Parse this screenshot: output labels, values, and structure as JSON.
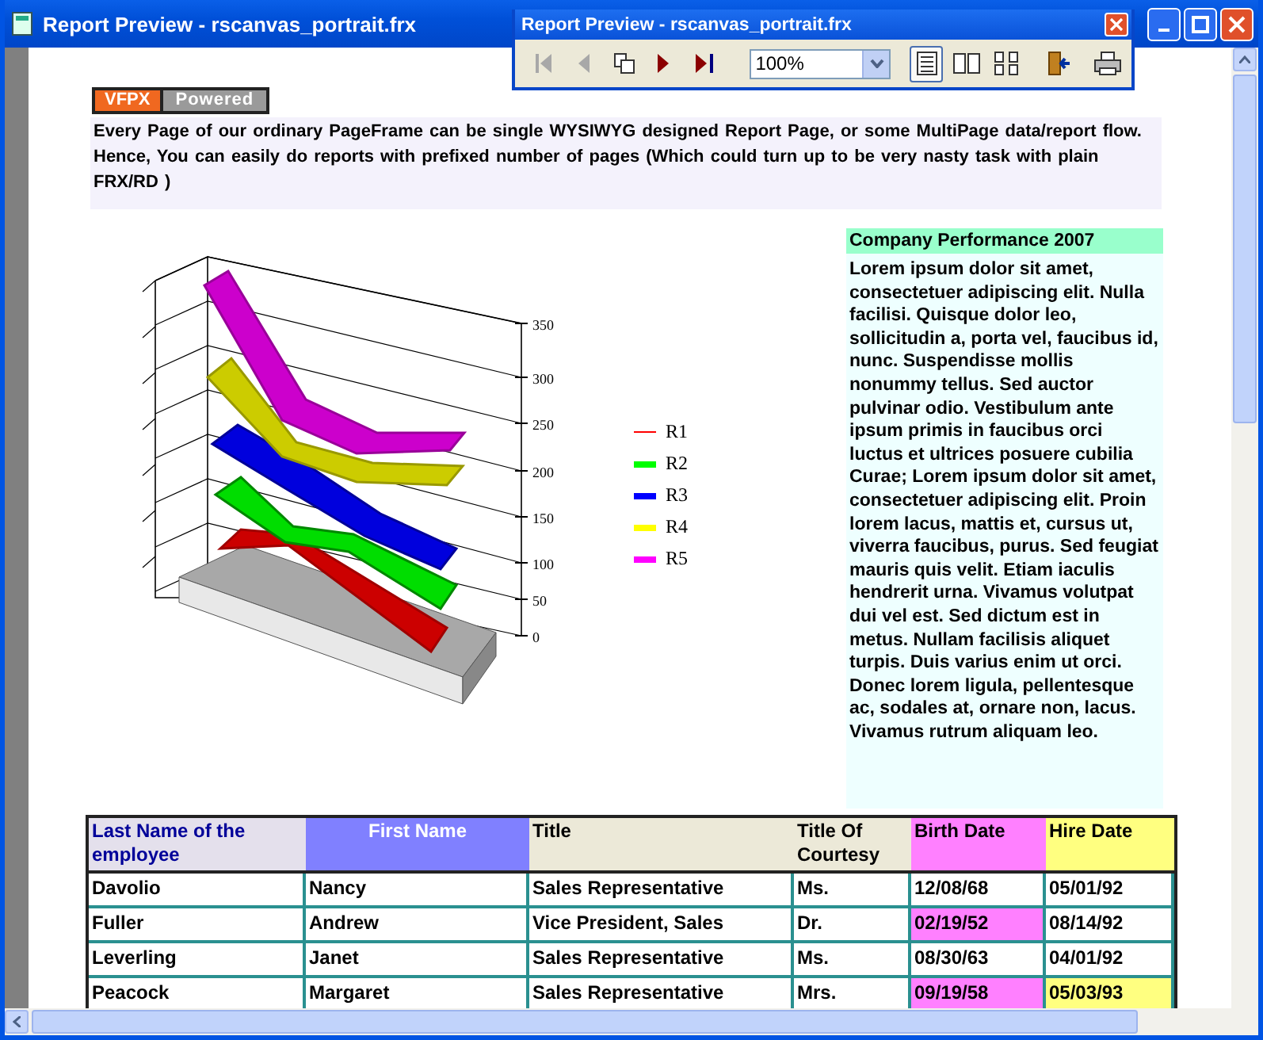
{
  "window": {
    "title": "Report Preview - rscanvas_portrait.frx"
  },
  "toolbar": {
    "title": "Report Preview - rscanvas_portrait.frx",
    "zoom": "100%",
    "nav": [
      {
        "kind": "first",
        "disabled": true
      },
      {
        "kind": "prev",
        "disabled": true
      },
      {
        "kind": "goto",
        "disabled": false
      },
      {
        "kind": "next",
        "disabled": false
      },
      {
        "kind": "last",
        "disabled": false
      }
    ],
    "views": [
      {
        "kind": "one",
        "selected": true
      },
      {
        "kind": "two",
        "selected": false
      },
      {
        "kind": "four",
        "selected": false
      }
    ]
  },
  "logo": {
    "left": "VFPX",
    "right": "Powered"
  },
  "intro": "Every Page of our ordinary PageFrame can be single  WYSIWYG designed Report Page, or some MultiPage data/report  flow.  Hence, You can easily do reports with prefixed number of pages (Which could turn up to be very nasty task with plain FRX/RD )",
  "chart": {
    "right_ticks": [
      "350",
      "300",
      "250",
      "200",
      "150",
      "100",
      "50",
      "0"
    ],
    "legend": [
      {
        "name": "R1",
        "color": "#ff0000"
      },
      {
        "name": "R2",
        "color": "#00ff00"
      },
      {
        "name": "R3",
        "color": "#0000ff"
      },
      {
        "name": "R4",
        "color": "#ffff00"
      },
      {
        "name": "R5",
        "color": "#ff00ff"
      }
    ]
  },
  "side_panel": {
    "title": "Company Performance 2007",
    "body": "Lorem ipsum dolor sit amet, consectetuer adipiscing elit. Nulla facilisi. Quisque dolor leo, sollicitudin a, porta vel, faucibus id, nunc. Suspendisse mollis nonummy tellus. Sed auctor pulvinar odio. Vestibulum ante ipsum primis in faucibus orci luctus et ultrices posuere cubilia Curae; Lorem ipsum dolor sit amet, consectetuer adipiscing elit. Proin lorem lacus, mattis et, cursus ut, viverra faucibus, purus. Sed feugiat mauris quis velit. Etiam iaculis hendrerit urna. Vivamus volutpat dui vel est. Sed dictum est in metus. Nullam facilisis aliquet turpis. Duis varius enim ut orci. Donec lorem ligula, pellentesque ac, sodales at, ornare non, lacus. Vivamus rutrum aliquam leo."
  },
  "table": {
    "columns": [
      {
        "label": "Last Name of the employee",
        "color": "#e4e0ec"
      },
      {
        "label": "First Name",
        "color": "#8080ff"
      },
      {
        "label": "Title",
        "color": "#ece9d8"
      },
      {
        "label": "Title Of Courtesy",
        "color": "#ece9d8"
      },
      {
        "label": "Birth Date",
        "color": "#ff80ff"
      },
      {
        "label": "Hire Date",
        "color": "#ffff80"
      }
    ],
    "rows": [
      {
        "cells": [
          {
            "text": "Davolio",
            "highlighted": false
          },
          {
            "text": "Nancy",
            "highlighted": false
          },
          {
            "text": "Sales Representative",
            "highlighted": false
          },
          {
            "text": "Ms.",
            "highlighted": false
          },
          {
            "text": "12/08/68",
            "highlighted": false
          },
          {
            "text": "05/01/92",
            "highlighted": false
          }
        ]
      },
      {
        "cells": [
          {
            "text": "Fuller",
            "highlighted": false
          },
          {
            "text": "Andrew",
            "highlighted": false
          },
          {
            "text": "Vice President, Sales",
            "highlighted": false
          },
          {
            "text": "Dr.",
            "highlighted": false
          },
          {
            "text": "02/19/52",
            "highlighted": true
          },
          {
            "text": "08/14/92",
            "highlighted": false
          }
        ]
      },
      {
        "cells": [
          {
            "text": "Leverling",
            "highlighted": false
          },
          {
            "text": "Janet",
            "highlighted": false
          },
          {
            "text": "Sales Representative",
            "highlighted": false
          },
          {
            "text": "Ms.",
            "highlighted": false
          },
          {
            "text": "08/30/63",
            "highlighted": false
          },
          {
            "text": "04/01/92",
            "highlighted": false
          }
        ]
      },
      {
        "cells": [
          {
            "text": "Peacock",
            "highlighted": false
          },
          {
            "text": "Margaret",
            "highlighted": false
          },
          {
            "text": "Sales Representative",
            "highlighted": false
          },
          {
            "text": "Mrs.",
            "highlighted": false
          },
          {
            "text": "09/19/58",
            "highlighted": true
          },
          {
            "text": "05/03/93",
            "highlighted": true
          }
        ]
      }
    ]
  }
}
